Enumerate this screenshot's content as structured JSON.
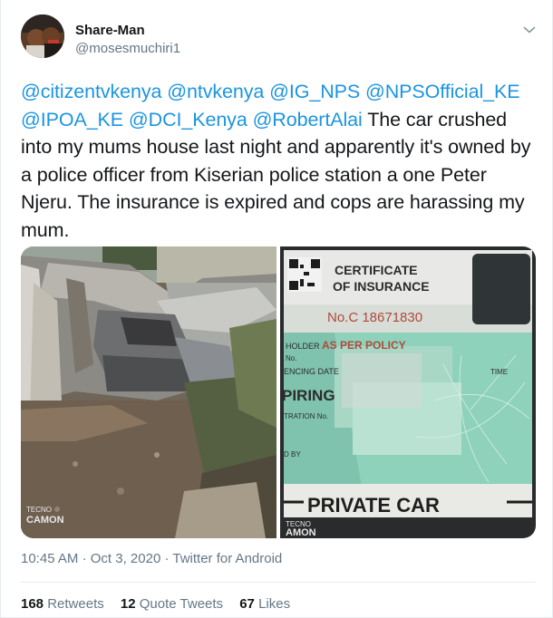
{
  "tweet": {
    "display_name": "Share-Man",
    "handle": "@mosesmuchiri1",
    "mentions": [
      "@citizentvkenya",
      "@ntvkenya",
      "@IG_NPS",
      "@NPSOfficial_KE",
      "@IPOA_KE",
      "@DCI_Kenya",
      "@RobertAlai"
    ],
    "body": "The car crushed into my mums house last night and apparently it's owned by a police officer from  Kiserian police station a one Peter Njeru. The insurance is expired and cops are harassing my mum.",
    "time": "10:45 AM",
    "date": "Oct 3, 2020",
    "source": "Twitter for Android",
    "separator": "·"
  },
  "photos": {
    "left_watermark_brand": "TECNO",
    "left_watermark_model": "CAMON",
    "right_watermark_brand": "TECNO",
    "right_watermark_model": "AMON",
    "certificate_title_1": "CERTIFICATE",
    "certificate_title_2": "OF INSURANCE",
    "certificate_number": "No.C  18671830",
    "holder_label": "HOLDER",
    "holder_value": "AS PER POLICY",
    "no_label": "No.",
    "commencing_label": "ENCING DATE",
    "time_label": "TIME",
    "expiring_label": "PIRING",
    "registration_label": "TRATION No.",
    "by_label": "D BY",
    "private_car": "PRIVATE CAR"
  },
  "stats": {
    "retweets_count": "168",
    "retweets_label": "Retweets",
    "quotes_count": "12",
    "quotes_label": "Quote Tweets",
    "likes_count": "67",
    "likes_label": "Likes"
  },
  "colors": {
    "link": "#1b95e0",
    "secondary_text": "#657786",
    "divider": "#e6ecf0"
  },
  "icons": {
    "menu": "chevron-down-icon"
  }
}
